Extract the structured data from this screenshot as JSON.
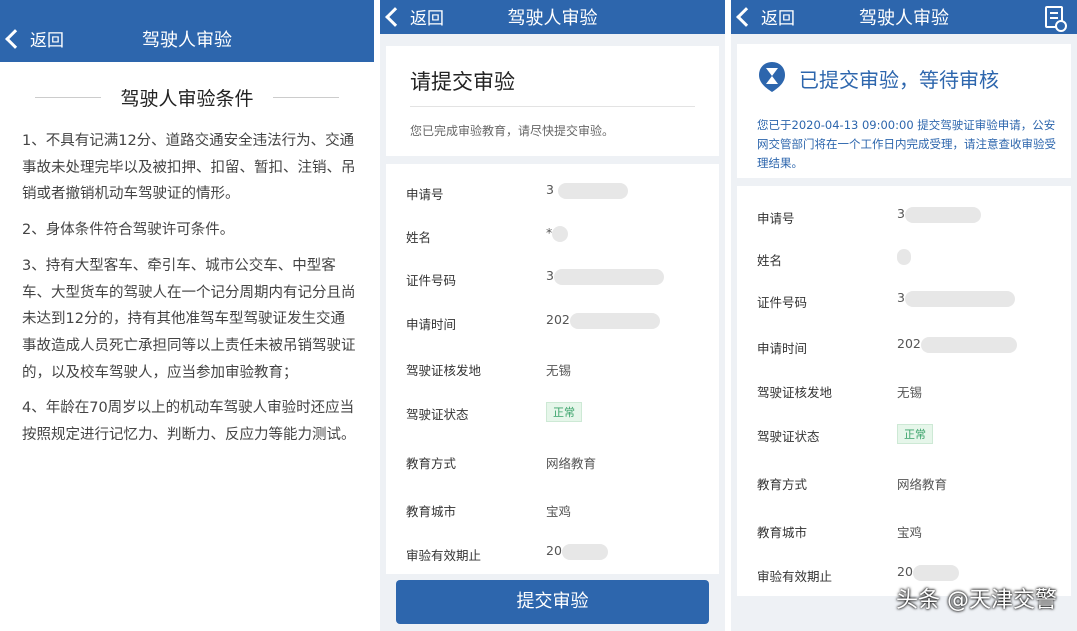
{
  "panel1": {
    "top_bar": {
      "back_label": "返回",
      "title": "驾驶人审验"
    },
    "conditions_title": "驾驶人审验条件",
    "conditions": [
      "1、不具有记满12分、道路交通安全违法行为、交通事故未处理完毕以及被扣押、扣留、暂扣、注销、吊销或者撤销机动车驾驶证的情形。",
      "2、身体条件符合驾驶许可条件。",
      "3、持有大型客车、牵引车、城市公交车、中型客车、大型货车的驾驶人在一个记分周期内有记分且尚未达到12分的，持有其他准驾车型驾驶证发生交通事故造成人员死亡承担同等以上责任未被吊销驾驶证的，以及校车驾驶人，应当参加审验教育；",
      "4、年龄在70周岁以上的机动车驾驶人审验时还应当按照规定进行记忆力、判断力、反应力等能力测试。"
    ]
  },
  "panel2": {
    "top_bar": {
      "back_label": "返回",
      "title": "驾驶人审验"
    },
    "heading": "请提交审验",
    "hint": "您已完成审验教育，请尽快提交审验。",
    "fields": [
      {
        "label": "申请号",
        "value": "3"
      },
      {
        "label": "姓名",
        "value": "*"
      },
      {
        "label": "证件号码",
        "value": "3"
      },
      {
        "label": "申请时间",
        "value": "202"
      },
      {
        "label": "驾驶证核发地",
        "value": "无锡"
      },
      {
        "label": "驾驶证状态",
        "value": "正常"
      },
      {
        "label": "教育方式",
        "value": "网络教育"
      },
      {
        "label": "教育城市",
        "value": "宝鸡"
      },
      {
        "label": "审验有效期止",
        "value": "20"
      }
    ],
    "submit_label": "提交审验"
  },
  "panel3": {
    "top_bar": {
      "back_label": "返回",
      "title": "驾驶人审验"
    },
    "status_title": "已提交审验，等待审核",
    "status_text": "您已于2020-04-13 09:00:00 提交驾驶证审验申请，公安网交管部门将在一个工作日内完成受理，请注意查收审验受理结果。",
    "fields": [
      {
        "label": "申请号",
        "value": "3"
      },
      {
        "label": "姓名",
        "value": ""
      },
      {
        "label": "证件号码",
        "value": "3"
      },
      {
        "label": "申请时间",
        "value": "202"
      },
      {
        "label": "驾驶证核发地",
        "value": "无锡"
      },
      {
        "label": "驾驶证状态",
        "value": "正常"
      },
      {
        "label": "教育方式",
        "value": "网络教育"
      },
      {
        "label": "教育城市",
        "value": "宝鸡"
      },
      {
        "label": "审验有效期止",
        "value": "20"
      }
    ]
  },
  "watermark": "头条 @天津交警",
  "colors": {
    "primary": "#2d66ad",
    "status_green": "#3aa36a",
    "background": "#eef1f5"
  }
}
